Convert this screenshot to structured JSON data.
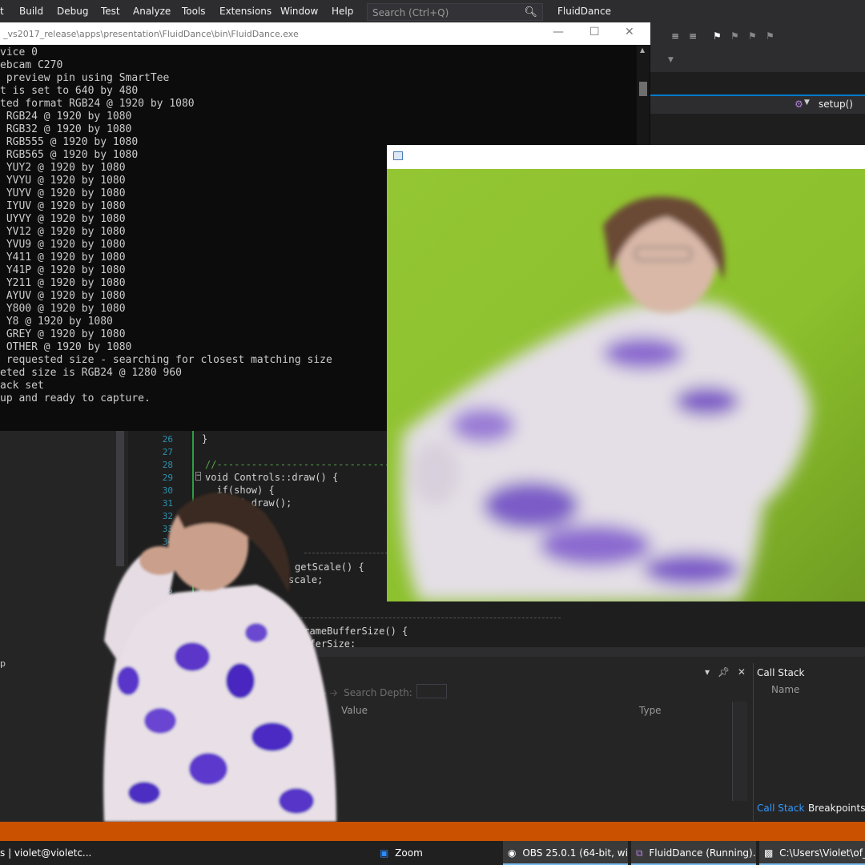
{
  "menubar": {
    "items": [
      "t",
      "Build",
      "Debug",
      "Test",
      "Analyze",
      "Tools",
      "Extensions",
      "Window",
      "Help"
    ],
    "search_placeholder": "Search (Ctrl+Q)",
    "solution_name": "FluidDance"
  },
  "editor_nav": {
    "method": "setup()"
  },
  "console": {
    "title": "_vs2017_release\\apps\\presentation\\FluidDance\\bin\\FluidDance.exe",
    "lines": [
      "vice 0",
      "ebcam C270",
      " preview pin using SmartTee",
      "t is set to 640 by 480",
      "ted format RGB24 @ 1920 by 1080",
      " RGB24 @ 1920 by 1080",
      " RGB32 @ 1920 by 1080",
      " RGB555 @ 1920 by 1080",
      " RGB565 @ 1920 by 1080",
      " YUY2 @ 1920 by 1080",
      " YVYU @ 1920 by 1080",
      " YUYV @ 1920 by 1080",
      " IYUV @ 1920 by 1080",
      " UYVY @ 1920 by 1080",
      " YV12 @ 1920 by 1080",
      " YVU9 @ 1920 by 1080",
      " Y411 @ 1920 by 1080",
      " Y41P @ 1920 by 1080",
      " Y211 @ 1920 by 1080",
      " AYUV @ 1920 by 1080",
      " Y800 @ 1920 by 1080",
      " Y8 @ 1920 by 1080",
      " GREY @ 1920 by 1080",
      " OTHER @ 1920 by 1080",
      " requested size - searching for closest matching size",
      "eted size is RGB24 @ 1280 960",
      "ack set",
      "up and ready to capture."
    ]
  },
  "code_editor": {
    "line_numbers": [
      "26",
      "27",
      "28",
      "29",
      "30",
      "31",
      "32",
      "33",
      "34",
      "38",
      "39"
    ],
    "lines": [
      {
        "text": "}",
        "color": "#d4d4d4"
      },
      {
        "text": "//--------------------------------------------",
        "color": "#57a64a"
      },
      {
        "text": "void Controls::draw() {",
        "color": "#d4d4d4"
      },
      {
        "text": "  if(show) {",
        "color": "#d4d4d4"
      },
      {
        "text": "    gui.draw();",
        "color": "#d4d4d4"
      },
      {
        "text": "getScale() {",
        "color": "#d4d4d4"
      },
      {
        "text": "scale;",
        "color": "#d4d4d4"
      },
      {
        "text": "}",
        "color": "#d4d4d4"
      },
      {
        "text": "FrameBufferSize() {",
        "color": "#d4d4d4"
      },
      {
        "text": "ufferSize;",
        "color": "#d4d4d4"
      }
    ]
  },
  "bottom_panel": {
    "search_depth_label": "Search Depth:",
    "columns": [
      "Value",
      "Type"
    ],
    "left_item": "p"
  },
  "callstack_panel": {
    "title": "Call Stack",
    "column": "Name",
    "tabs": [
      "Call Stack",
      "Breakpoints"
    ]
  },
  "taskbar": {
    "items": [
      "s | violet@violetc...",
      "Zoom",
      "OBS 25.0.1 (64-bit, wi...",
      "FluidDance (Running)...",
      "C:\\Users\\Violet\\of_v"
    ]
  },
  "colors": {
    "vs_dark": "#1e1e1e",
    "vs_accent": "#007acc",
    "status_debug": "#ca5100",
    "console_bg": "#0c0c0c",
    "greenscreen": "#8fc32c"
  }
}
